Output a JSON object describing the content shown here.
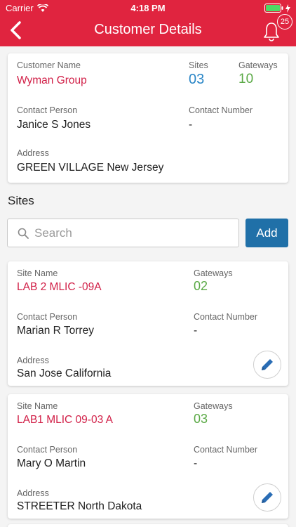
{
  "status_bar": {
    "carrier": "Carrier",
    "time": "4:18 PM"
  },
  "header": {
    "title": "Customer Details",
    "notification_count": "25"
  },
  "customer": {
    "name_label": "Customer Name",
    "name": "Wyman Group",
    "sites_label": "Sites",
    "sites": "03",
    "gateways_label": "Gateways",
    "gateways": "10",
    "contact_person_label": "Contact Person",
    "contact_person": "Janice S Jones",
    "contact_number_label": "Contact Number",
    "contact_number": "-",
    "address_label": "Address",
    "address": "GREEN VILLAGE New Jersey"
  },
  "sites_section": {
    "title": "Sites",
    "search_placeholder": "Search",
    "add_label": "Add",
    "items": [
      {
        "site_name_label": "Site Name",
        "site_name": "LAB 2 MLIC -09A",
        "gateways_label": "Gateways",
        "gateways": "02",
        "contact_person_label": "Contact Person",
        "contact_person": "Marian R Torrey",
        "contact_number_label": "Contact Number",
        "contact_number": "-",
        "address_label": "Address",
        "address": "San Jose California"
      },
      {
        "site_name_label": "Site Name",
        "site_name": "LAB1 MLIC 09-03 A",
        "gateways_label": "Gateways",
        "gateways": "03",
        "contact_person_label": "Contact Person",
        "contact_person": "Mary O Martin",
        "contact_number_label": "Contact Number",
        "contact_number": "-",
        "address_label": "Address",
        "address": "STREETER North Dakota"
      }
    ]
  },
  "colors": {
    "header": "#e0243f",
    "accent_red": "#d11f47",
    "sites_blue": "#2a86c7",
    "gateway_green": "#5aa945",
    "add_button": "#2070a8"
  }
}
